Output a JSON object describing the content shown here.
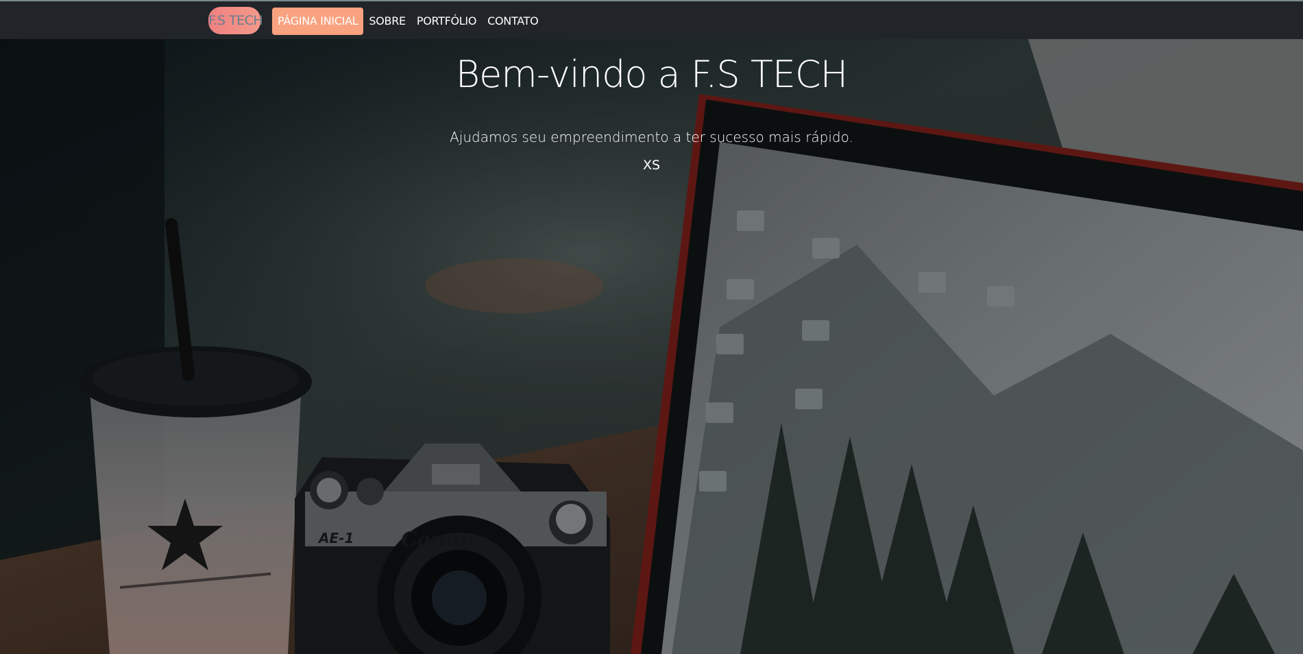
{
  "navbar": {
    "brand": "F.S TECH",
    "items": [
      {
        "label": "PÁGINA INICIAL",
        "active": true
      },
      {
        "label": "SOBRE",
        "active": false
      },
      {
        "label": "PORTFÓLIO",
        "active": false
      },
      {
        "label": "CONTATO",
        "active": false
      }
    ]
  },
  "hero": {
    "title": "Bem-vindo a F.S TECH",
    "subtitle": "Ajudamos seu empreendimento a ter sucesso mais rápido.",
    "extra": "XS",
    "camera_label": "Canon",
    "camera_model": "AE-1"
  },
  "colors": {
    "navbar_bg": "#212529",
    "brand_bg": "#f08080",
    "active_bg": "#f9a27f",
    "text": "#ffffff"
  }
}
